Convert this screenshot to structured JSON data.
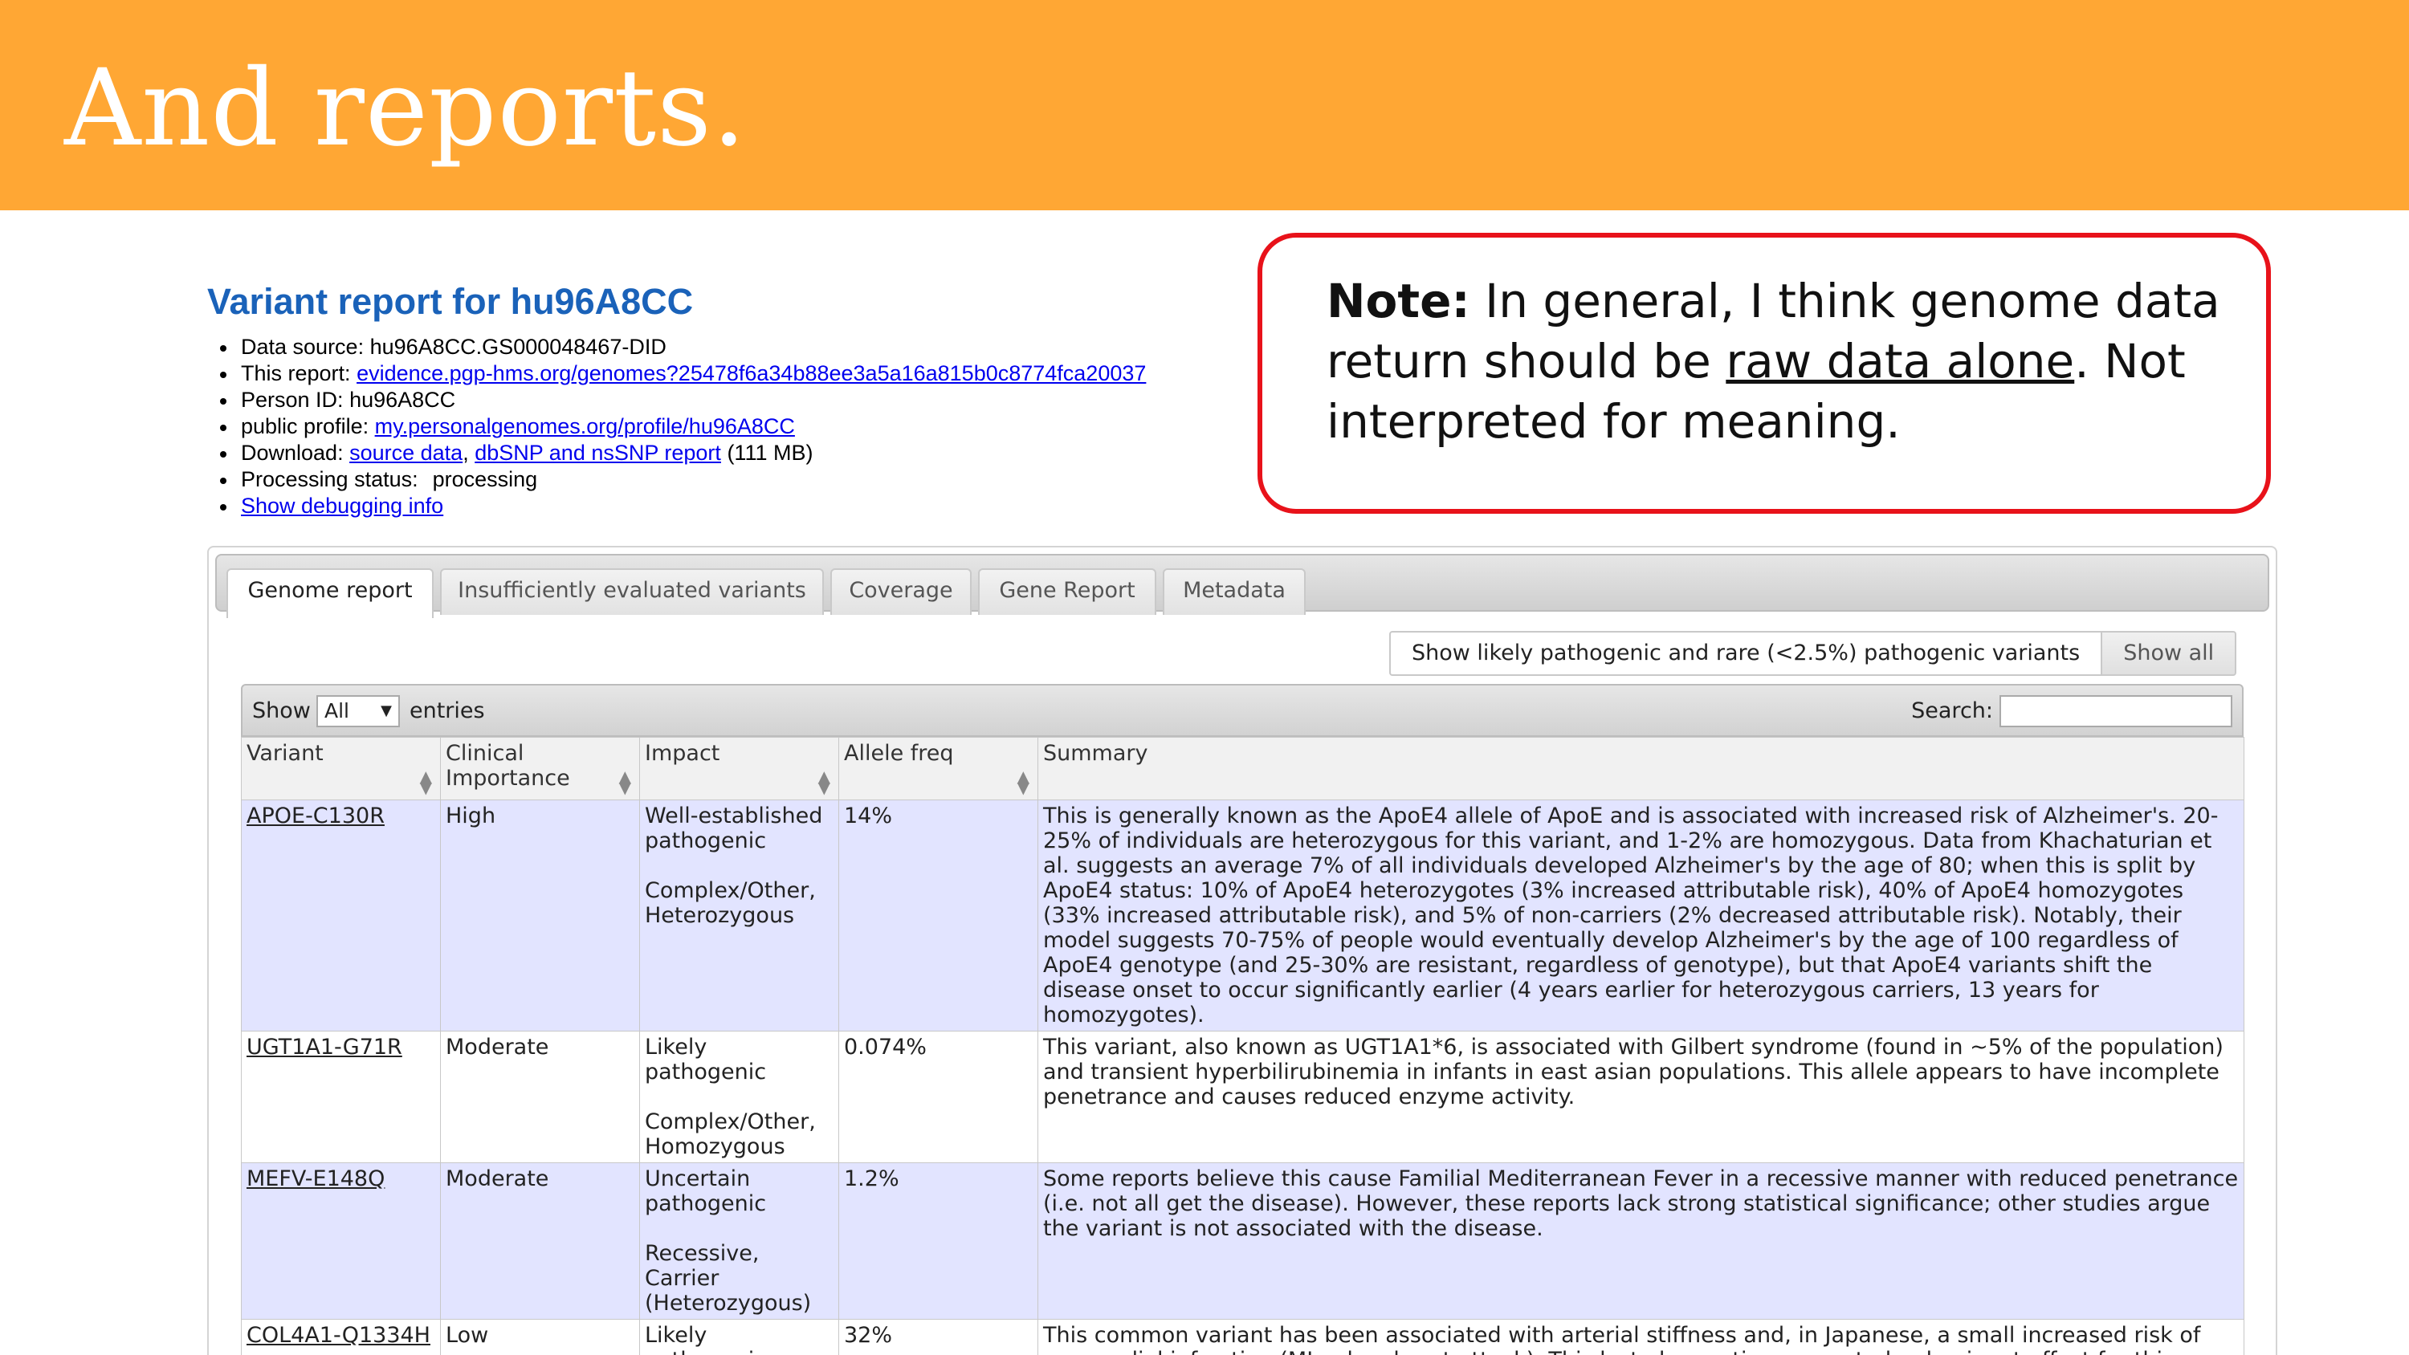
{
  "slide": {
    "title": "And reports."
  },
  "report": {
    "title": "Variant report for hu96A8CC",
    "data_source_label": "Data source:",
    "data_source_value": "hu96A8CC.GS000048467-DID",
    "this_report_label": "This report:",
    "this_report_link": "evidence.pgp-hms.org/genomes?25478f6a34b88ee3a5a16a815b0c8774fca20037",
    "person_id_label": "Person ID:",
    "person_id_value": "hu96A8CC",
    "public_profile_label": "public profile:",
    "public_profile_link": "my.personalgenomes.org/profile/hu96A8CC",
    "download_label": "Download:",
    "download_link_1": "source data",
    "download_sep": ",",
    "download_link_2": "dbSNP and nsSNP report",
    "download_size": "(111 MB)",
    "processing_label": "Processing status:",
    "processing_value": "processing",
    "debug_link": "Show debugging info"
  },
  "note": {
    "bold": "Note:",
    "text_1": " In general, I think genome data return should be ",
    "underlined": "raw data alone",
    "text_2": ". Not interpreted for meaning."
  },
  "tabs": [
    {
      "label": "Genome report",
      "active": true
    },
    {
      "label": "Insufficiently evaluated variants",
      "active": false
    },
    {
      "label": "Coverage",
      "active": false
    },
    {
      "label": "Gene Report",
      "active": false
    },
    {
      "label": "Metadata",
      "active": false
    }
  ],
  "filters": {
    "pathogenic": "Show likely pathogenic and rare (<2.5%) pathogenic variants",
    "all": "Show all"
  },
  "table_controls": {
    "show": "Show",
    "selected": "All",
    "entries": "entries",
    "search": "Search:"
  },
  "columns": {
    "variant": "Variant",
    "clinical": "Clinical Importance",
    "impact": "Impact",
    "allele": "Allele freq",
    "summary": "Summary"
  },
  "rows": [
    {
      "variant": "APOE-C130R",
      "clinical": "High",
      "impact_1": "Well-established pathogenic",
      "impact_2": "Complex/Other, Heterozygous",
      "allele": "14%",
      "summary": "This is generally known as the ApoE4 allele of ApoE and is associated with increased risk of Alzheimer's. 20-25% of individuals are heterozygous for this variant, and 1-2% are homozygous. Data from Khachaturian et al. suggests an average 7% of all individuals developed Alzheimer's by the age of 80; when this is split by ApoE4 status: 10% of ApoE4 heterozygotes (3% increased attributable risk), 40% of ApoE4 homozygotes (33% increased attributable risk), and 5% of non-carriers (2% decreased attributable risk). Notably, their model suggests 70-75% of people would eventually develop Alzheimer's by the age of 100 regardless of ApoE4 genotype (and 25-30% are resistant, regardless of genotype), but that ApoE4 variants shift the disease onset to occur significantly earlier (4 years earlier for heterozygous carriers, 13 years for homozygotes)."
    },
    {
      "variant": "UGT1A1-G71R",
      "clinical": "Moderate",
      "impact_1": "Likely pathogenic",
      "impact_2": "Complex/Other, Homozygous",
      "allele": "0.074%",
      "summary": "This variant, also known as UGT1A1*6, is associated with Gilbert syndrome (found in ~5% of the population) and transient hyperbilirubinemia in infants in east asian populations. This allele appears to have incomplete penetrance and causes reduced enzyme activity."
    },
    {
      "variant": "MEFV-E148Q",
      "clinical": "Moderate",
      "impact_1": "Uncertain pathogenic",
      "impact_2": "Recessive, Carrier (Heterozygous)",
      "allele": "1.2%",
      "summary": "Some reports believe this cause Familial Mediterranean Fever in a recessive manner with reduced penetrance (i.e. not all get the disease). However, these reports lack strong statistical significance; other studies argue the variant is not associated with the disease."
    },
    {
      "variant": "COL4A1-Q1334H",
      "clinical": "Low",
      "impact_1": "Likely pathogenic",
      "impact_2": "",
      "allele": "32%",
      "summary": "This common variant has been associated with arterial stiffness and, in Japanese, a small increased risk of myocardial infarction (MI, a.k.a. heart attack). This last observation supported a dominant effect for this"
    }
  ]
}
